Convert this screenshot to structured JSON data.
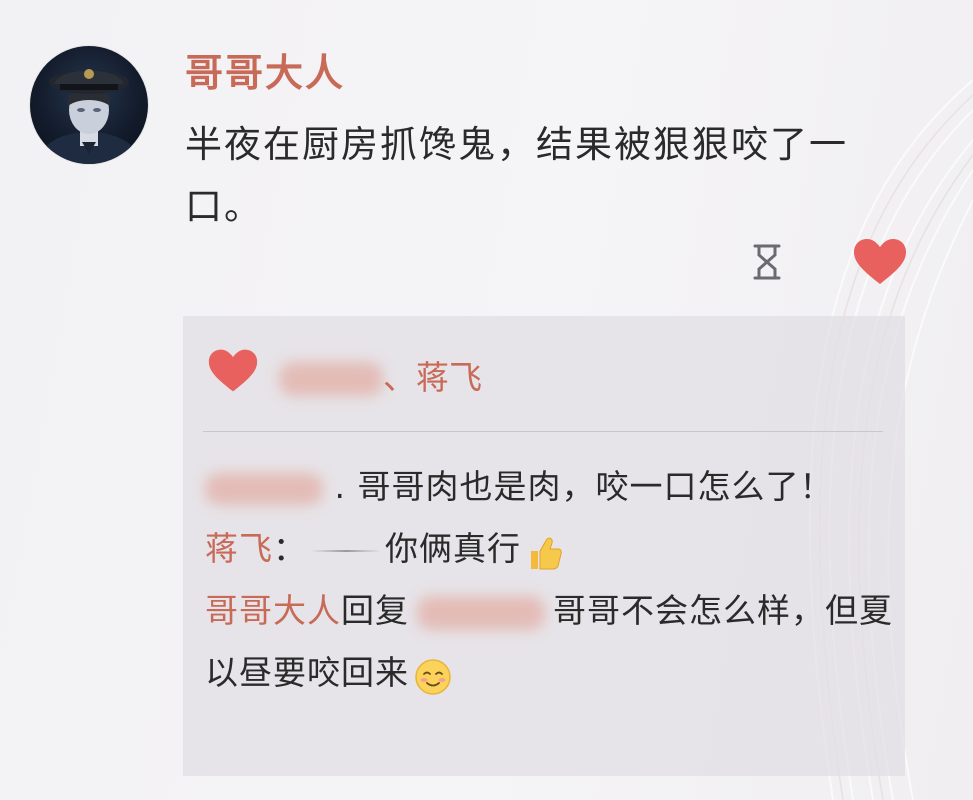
{
  "post": {
    "author": "哥哥大人",
    "text": "半夜在厨房抓馋鬼，结果被狠狠咬了一口。"
  },
  "actions": {
    "hourglass_icon": "hourglass-icon",
    "like_icon": "heart-icon"
  },
  "likes": {
    "separator": "、",
    "names_tail": "蒋飞"
  },
  "comments": [
    {
      "prefix": ".",
      "text": "哥哥肉也是肉，咬一口怎么了！"
    },
    {
      "author": "蒋飞",
      "sep": "：",
      "text": "你俩真行",
      "emoji": "thumbs-up-emoji"
    },
    {
      "author": "哥哥大人",
      "reply_word": "回复",
      "text": "哥哥不会怎么样，但夏以昼要咬回来",
      "emoji": "blush-emoji"
    }
  ],
  "colors": {
    "accent": "#c86a58",
    "heart": "#e8615e",
    "text": "#2a2a2a",
    "comment_bg": "#e0dee3"
  }
}
